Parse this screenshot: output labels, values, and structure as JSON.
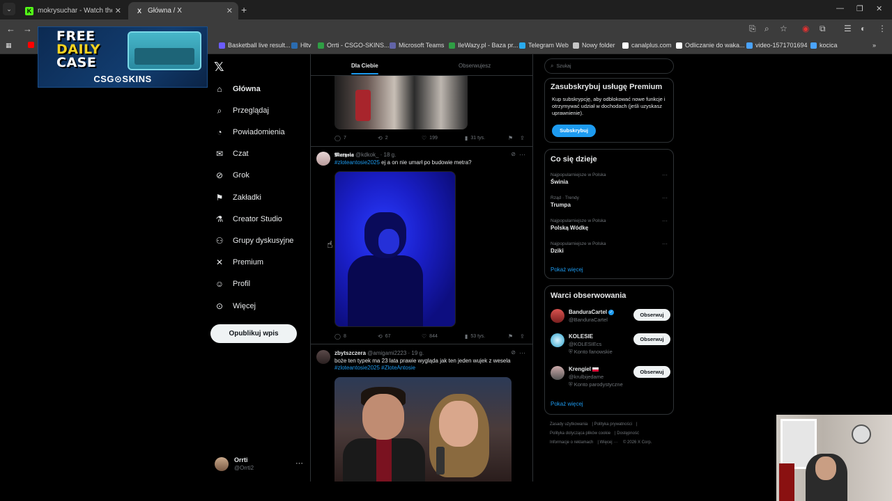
{
  "browser": {
    "tabs": [
      {
        "title": "mokrysuchar - Watch the VOD",
        "favicon": "K",
        "favicon_color": "#53fc18",
        "active": false
      },
      {
        "title": "Główna / X",
        "favicon": "X",
        "favicon_color": "#ffffff",
        "active": true
      }
    ],
    "bookmarks": [
      {
        "label": "Basketball live result...",
        "icon_color": "#6b5cff"
      },
      {
        "label": "Hltv",
        "icon_color": "#2b6cb0"
      },
      {
        "label": "Orrti - CSGO-SKINS...",
        "icon_color": "#2f9e44"
      },
      {
        "label": "Microsoft Teams",
        "icon_color": "#6264a7"
      },
      {
        "label": "IleWazy.pl - Baza pr...",
        "icon_color": "#2f9e44"
      },
      {
        "label": "Telegram Web",
        "icon_color": "#2aabee"
      },
      {
        "label": "Nowy folder",
        "icon_color": "#c7c7c7"
      },
      {
        "label": "canalplus.com",
        "icon_color": "#ffffff"
      },
      {
        "label": "Odliczanie do waka...",
        "icon_color": "#ffffff"
      },
      {
        "label": "video-1571701694",
        "icon_color": "#4aa3ff"
      },
      {
        "label": "kocica",
        "icon_color": "#4aa3ff"
      }
    ]
  },
  "ad": {
    "line1": "FREE",
    "line2": "DAILY",
    "line3": "CASE",
    "logo": "CSG⊙SKINS"
  },
  "nav": {
    "items": [
      {
        "label": "Główna",
        "icon": "home-icon",
        "glyph": "⌂"
      },
      {
        "label": "Przeglądaj",
        "icon": "search-icon",
        "glyph": "⌕"
      },
      {
        "label": "Powiadomienia",
        "icon": "bell-icon",
        "glyph": "◔"
      },
      {
        "label": "Czat",
        "icon": "mail-icon",
        "glyph": "✉"
      },
      {
        "label": "Grok",
        "icon": "grok-icon",
        "glyph": "⊘"
      },
      {
        "label": "Zakładki",
        "icon": "bookmark-icon",
        "glyph": "⚑"
      },
      {
        "label": "Creator Studio",
        "icon": "flask-icon",
        "glyph": "⚗"
      },
      {
        "label": "Grupy dyskusyjne",
        "icon": "people-icon",
        "glyph": "⚇"
      },
      {
        "label": "Premium",
        "icon": "x-icon",
        "glyph": "✕"
      },
      {
        "label": "Profil",
        "icon": "person-icon",
        "glyph": "☺"
      },
      {
        "label": "Więcej",
        "icon": "more-circle-icon",
        "glyph": "⊙"
      }
    ],
    "post_button": "Opublikuj wpis",
    "profile": {
      "name": "Orrti",
      "handle": "@Orrti2"
    }
  },
  "timeline": {
    "tabs": {
      "for_you": "Dla Ciebie",
      "following": "Obserwujesz"
    },
    "tweet0_actions": {
      "replies": "7",
      "reposts": "2",
      "likes": "199",
      "views": "31 tys."
    },
    "tweet1": {
      "name": "𝕸𝖆𝖗𝖞𝖘𝖎𝖆",
      "meta": "@kdkok_ · 18 g.",
      "hashtag": "#zloteantosie2025",
      "text": " ej a on nie umarł po budowie metra?",
      "actions": {
        "replies": "8",
        "reposts": "67",
        "likes": "844",
        "views": "53 tys."
      }
    },
    "tweet2": {
      "name": "zbytszczera",
      "meta": "@amigami2223 · 19 g.",
      "text": "boże ten typek ma 23 lata prawie wygląda jak ten jeden wujek z wesela",
      "hashtags": "#zloteantosie2025 #ZloteAntosie"
    }
  },
  "sidebar": {
    "search_placeholder": "Szukaj",
    "premium": {
      "title": "Zasubskrybuj usługę Premium",
      "desc": "Kup subskrypcję, aby odblokować nowe funkcje i otrzymywać udział w dochodach (jeśli uzyskasz uprawnienie).",
      "button": "Subskrybuj"
    },
    "trends": {
      "title": "Co się dzieje",
      "items": [
        {
          "context": "Najpopularniejsze w Polska",
          "name": "Świnia"
        },
        {
          "context": "Rząd · Trendy",
          "name": "Trumpa"
        },
        {
          "context": "Najpopularniejsze w Polska",
          "name": "Polską Wódkę"
        },
        {
          "context": "Najpopularniejsze w Polska",
          "name": "Dziki"
        }
      ],
      "more": "Pokaż więcej"
    },
    "who_to_follow": {
      "title": "Warci obserwowania",
      "items": [
        {
          "name": "BanduraCartel",
          "handle": "@BanduraCartel",
          "badge": "",
          "button": "Obserwuj"
        },
        {
          "name": "KOLESIE",
          "handle": "@KOLESIEcs",
          "badge": "Konto fanowskie",
          "button": "Obserwuj"
        },
        {
          "name": "Krengiel",
          "handle": "@krulbijedame",
          "badge": "Konto parodystyczne",
          "button": "Obserwuj"
        }
      ],
      "more": "Pokaż więcej"
    },
    "footer": [
      "Zasady użytkowania",
      "Polityka prywatności",
      "Polityka dotycząca plików cookie",
      "Dostępność",
      "Informacje o reklamach",
      "Więcej ···",
      "© 2026 X Corp."
    ]
  }
}
